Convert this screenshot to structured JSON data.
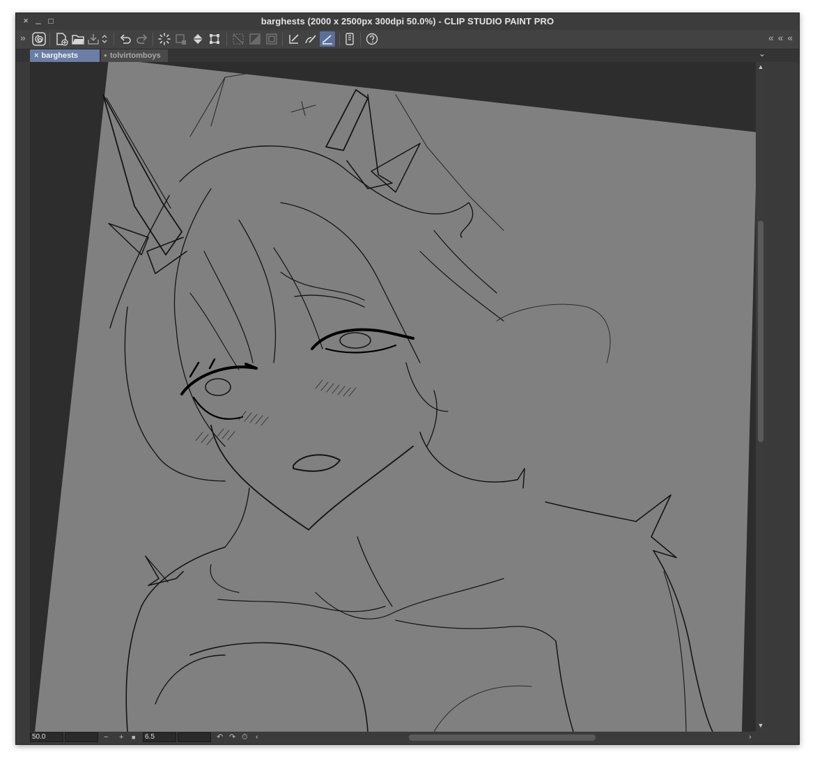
{
  "window": {
    "title": "barghests (2000 x 2500px 300dpi 50.0%)  - CLIP STUDIO PAINT PRO"
  },
  "window_controls": {
    "close": "×",
    "minimize": "_",
    "maximize": "□"
  },
  "toolbar": {
    "expand_left": "»",
    "collapse_right": "« « «",
    "buttons": [
      {
        "icon": "clip-studio-logo-icon"
      },
      {
        "icon": "new-file-icon"
      },
      {
        "icon": "open-folder-icon"
      },
      {
        "icon": "save-icon"
      },
      {
        "icon": "save-options-icon"
      },
      {
        "icon": "undo-icon"
      },
      {
        "icon": "redo-icon"
      },
      {
        "icon": "loading-spinner-icon"
      },
      {
        "icon": "clear-layer-icon"
      },
      {
        "icon": "fill-bucket-icon"
      },
      {
        "icon": "transform-icon"
      },
      {
        "icon": "deselect-icon"
      },
      {
        "icon": "invert-selection-icon"
      },
      {
        "icon": "show-selection-icon"
      },
      {
        "icon": "ruler-snap-icon"
      },
      {
        "icon": "special-ruler-snap-icon"
      },
      {
        "icon": "grid-snap-icon",
        "active": true
      },
      {
        "icon": "device-settings-icon"
      },
      {
        "icon": "help-icon"
      }
    ]
  },
  "tabs": [
    {
      "label": "barghests",
      "active": true,
      "close_glyph": "×"
    },
    {
      "label": "tolvirtomboys",
      "active": false,
      "modified_glyph": "●"
    }
  ],
  "tab_menu_glyph": "⌄",
  "canvas": {
    "background_color": "#2d2d2d",
    "paper_color": "#808080",
    "line_color": "#111111"
  },
  "status_bar": {
    "zoom_value": "50.0",
    "zoom_out_glyph": "−",
    "zoom_in_glyph": "+",
    "stop_glyph": "■",
    "rotation_value": "6.5",
    "rotate_left_glyph": "↶",
    "rotate_right_glyph": "↷",
    "reset_rotation_glyph": "⏱",
    "flip_glyph": "‹",
    "scroll_right_glyph": "›"
  },
  "scrollbar": {
    "up_glyph": "▲",
    "down_glyph": "▼"
  }
}
